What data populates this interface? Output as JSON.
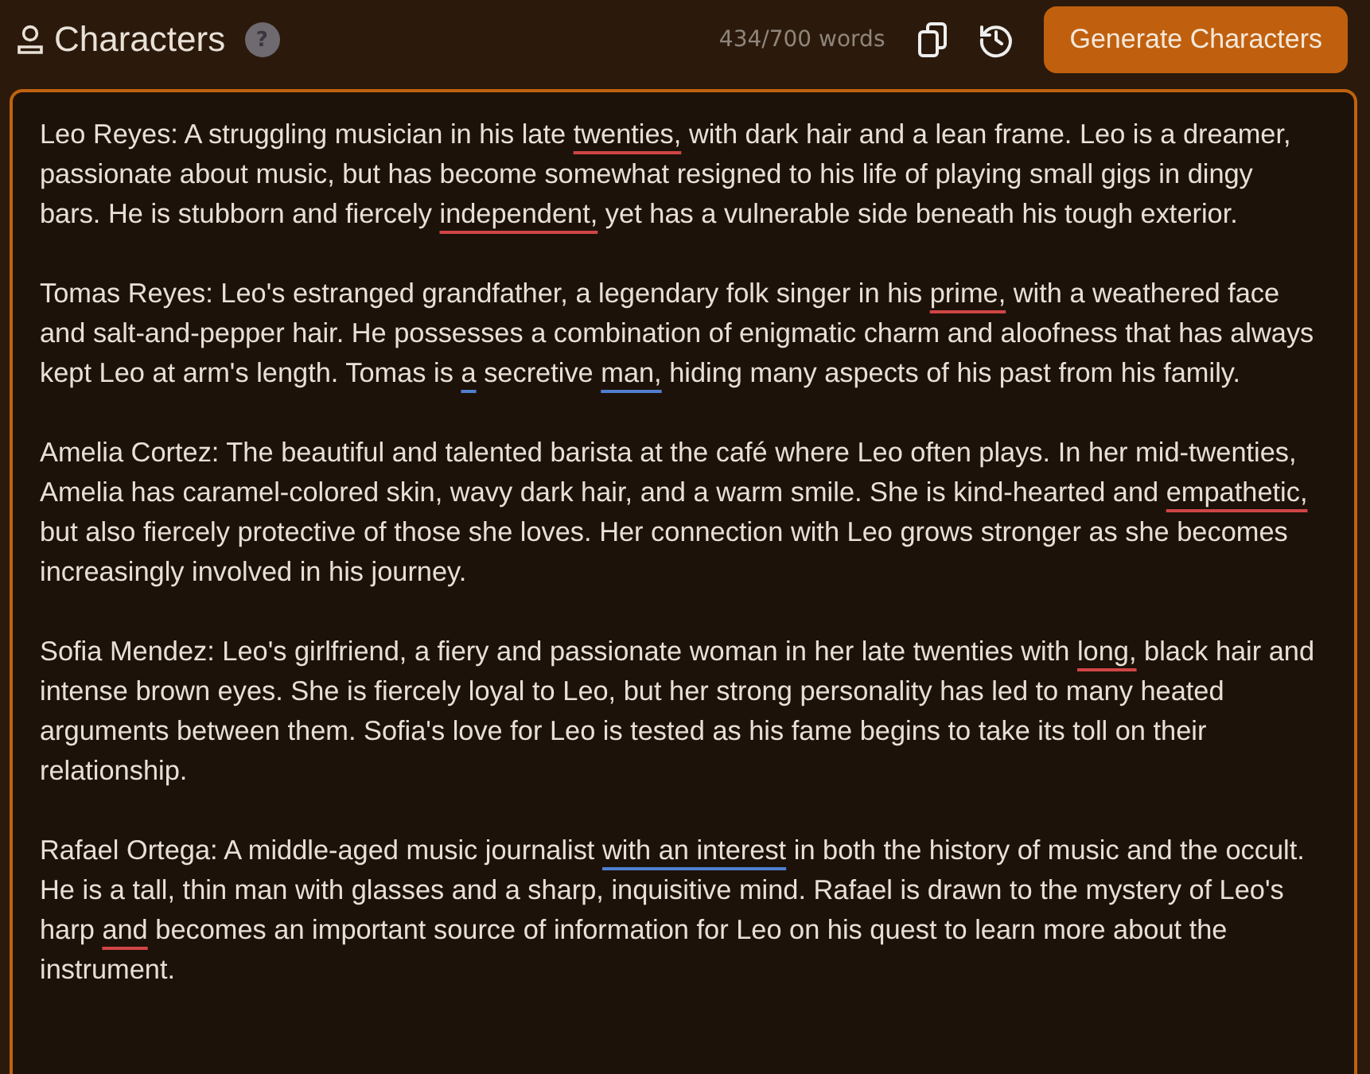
{
  "header": {
    "title": "Characters",
    "help": "?",
    "word_count": "434/700 words",
    "generate_button": "Generate Characters"
  },
  "editor": {
    "paragraphs": [
      [
        {
          "text": "Leo Reyes: A struggling musician in his late "
        },
        {
          "text": "twenties,",
          "kind": "spelling"
        },
        {
          "text": " with dark hair and a lean frame. Leo is a dreamer, passionate about music, but has become somewhat resigned to his life of playing small gigs in dingy bars. He is stubborn and fiercely "
        },
        {
          "text": "independent,",
          "kind": "spelling"
        },
        {
          "text": " yet has a vulnerable side beneath his tough exterior."
        }
      ],
      [
        {
          "text": "Tomas Reyes: Leo's estranged grandfather, a legendary folk singer in his "
        },
        {
          "text": "prime,",
          "kind": "spelling"
        },
        {
          "text": " with a weathered face and salt-and-pepper hair. He possesses a combination of enigmatic charm and aloofness that has always kept Leo at arm's length. Tomas is "
        },
        {
          "text": "a",
          "kind": "grammar"
        },
        {
          "text": " secretive "
        },
        {
          "text": "man,",
          "kind": "grammar"
        },
        {
          "text": " hiding many aspects of his past from his family."
        }
      ],
      [
        {
          "text": "Amelia Cortez: The beautiful and talented barista at the café where Leo often plays. In her mid-twenties, Amelia has caramel-colored skin, wavy dark hair, and a warm smile. She is kind-hearted and "
        },
        {
          "text": "empathetic,",
          "kind": "spelling"
        },
        {
          "text": " but also fiercely protective of those she loves. Her connection with Leo grows stronger as she becomes increasingly involved in his journey."
        }
      ],
      [
        {
          "text": "Sofia Mendez: Leo's girlfriend, a fiery and passionate woman in her late twenties with "
        },
        {
          "text": "long,",
          "kind": "spelling"
        },
        {
          "text": " black hair and intense brown eyes. She is fiercely loyal to Leo, but her strong personality has led to many heated arguments between them. Sofia's love for Leo is tested as his fame begins to take its toll on their relationship."
        }
      ],
      [
        {
          "text": "Rafael Ortega: A middle-aged music journalist "
        },
        {
          "text": "with an interest",
          "kind": "grammar"
        },
        {
          "text": " in both the history of music and the occult. He is a tall, thin man with glasses and a sharp, inquisitive mind. Rafael is drawn to the mystery of Leo's harp "
        },
        {
          "text": "and",
          "kind": "spelling"
        },
        {
          "text": " becomes an important source of information for Leo on his quest to learn more about the instrument."
        }
      ]
    ]
  }
}
